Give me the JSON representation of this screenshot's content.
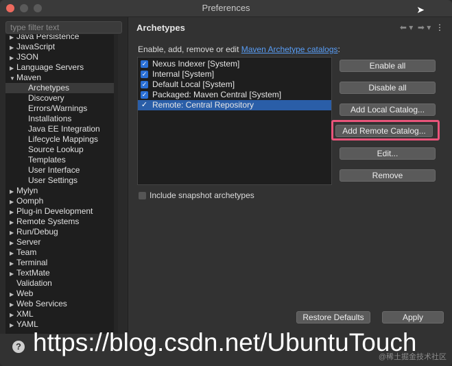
{
  "window": {
    "title": "Preferences"
  },
  "left": {
    "filter_placeholder": "type filter text",
    "tree": [
      {
        "label": "Java Persistence",
        "arrow": "▶",
        "indent": 0
      },
      {
        "label": "JavaScript",
        "arrow": "▶",
        "indent": 0
      },
      {
        "label": "JSON",
        "arrow": "▶",
        "indent": 0
      },
      {
        "label": "Language Servers",
        "arrow": "▶",
        "indent": 0
      },
      {
        "label": "Maven",
        "arrow": "▼",
        "indent": 0
      },
      {
        "label": "Archetypes",
        "arrow": "",
        "indent": 1,
        "selected": true
      },
      {
        "label": "Discovery",
        "arrow": "",
        "indent": 1
      },
      {
        "label": "Errors/Warnings",
        "arrow": "",
        "indent": 1
      },
      {
        "label": "Installations",
        "arrow": "",
        "indent": 1
      },
      {
        "label": "Java EE Integration",
        "arrow": "",
        "indent": 1
      },
      {
        "label": "Lifecycle Mappings",
        "arrow": "",
        "indent": 1
      },
      {
        "label": "Source Lookup",
        "arrow": "",
        "indent": 1
      },
      {
        "label": "Templates",
        "arrow": "",
        "indent": 1
      },
      {
        "label": "User Interface",
        "arrow": "",
        "indent": 1
      },
      {
        "label": "User Settings",
        "arrow": "",
        "indent": 1
      },
      {
        "label": "Mylyn",
        "arrow": "▶",
        "indent": 0
      },
      {
        "label": "Oomph",
        "arrow": "▶",
        "indent": 0
      },
      {
        "label": "Plug-in Development",
        "arrow": "▶",
        "indent": 0
      },
      {
        "label": "Remote Systems",
        "arrow": "▶",
        "indent": 0
      },
      {
        "label": "Run/Debug",
        "arrow": "▶",
        "indent": 0
      },
      {
        "label": "Server",
        "arrow": "▶",
        "indent": 0
      },
      {
        "label": "Team",
        "arrow": "▶",
        "indent": 0
      },
      {
        "label": "Terminal",
        "arrow": "▶",
        "indent": 0
      },
      {
        "label": "TextMate",
        "arrow": "▶",
        "indent": 0
      },
      {
        "label": "Validation",
        "arrow": "",
        "indent": 0
      },
      {
        "label": "Web",
        "arrow": "▶",
        "indent": 0
      },
      {
        "label": "Web Services",
        "arrow": "▶",
        "indent": 0
      },
      {
        "label": "XML",
        "arrow": "▶",
        "indent": 0
      },
      {
        "label": "YAML",
        "arrow": "▶",
        "indent": 0
      }
    ]
  },
  "page": {
    "title": "Archetypes",
    "desc_prefix": "Enable, add, remove or edit ",
    "desc_link": "Maven Archetype catalogs",
    "desc_suffix": ":",
    "catalogs": [
      {
        "label": "Nexus Indexer [System]",
        "checked": true
      },
      {
        "label": "Internal [System]",
        "checked": true
      },
      {
        "label": "Default Local [System]",
        "checked": true
      },
      {
        "label": "Packaged: Maven Central [System]",
        "checked": true
      },
      {
        "label": "Remote: Central Repository",
        "checked": true,
        "selected": true
      }
    ],
    "buttons": {
      "enable_all": "Enable all",
      "disable_all": "Disable all",
      "add_local": "Add Local Catalog...",
      "add_remote": "Add Remote Catalog...",
      "edit": "Edit...",
      "remove": "Remove"
    },
    "snapshot_label": "Include snapshot archetypes",
    "restore_defaults": "Restore Defaults",
    "apply": "Apply"
  },
  "overlay": {
    "watermark_url": "https://blog.csdn.net/UbuntuTouch",
    "watermark_small": "@稀土掘金技术社区"
  },
  "colors": {
    "accent": "#2a5ea8",
    "link": "#589df6",
    "highlight": "#e9547a"
  }
}
